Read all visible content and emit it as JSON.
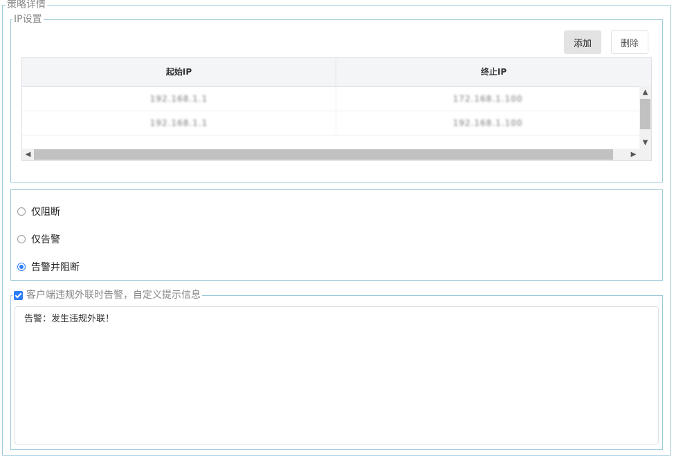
{
  "fieldsets": {
    "outer_title": "策略详情",
    "ip_title": "IP设置"
  },
  "toolbar": {
    "add_label": "添加",
    "delete_label": "删除"
  },
  "ip_table": {
    "columns": [
      "起始IP",
      "终止IP"
    ],
    "rows": [
      {
        "start": "192.168.1.1",
        "end": "172.168.1.100"
      },
      {
        "start": "192.168.1.1",
        "end": "192.168.1.100"
      }
    ]
  },
  "mode": {
    "options": [
      {
        "label": "仅阻断",
        "checked": false
      },
      {
        "label": "仅告警",
        "checked": false
      },
      {
        "label": "告警并阻断",
        "checked": true
      }
    ]
  },
  "alert": {
    "checkbox_label": "客户端违规外联时告警，自定义提示信息",
    "checked": true,
    "message": "告警：发生违规外联！"
  },
  "colors": {
    "border": "#9cc8d8",
    "accent": "#2d7ef7"
  }
}
